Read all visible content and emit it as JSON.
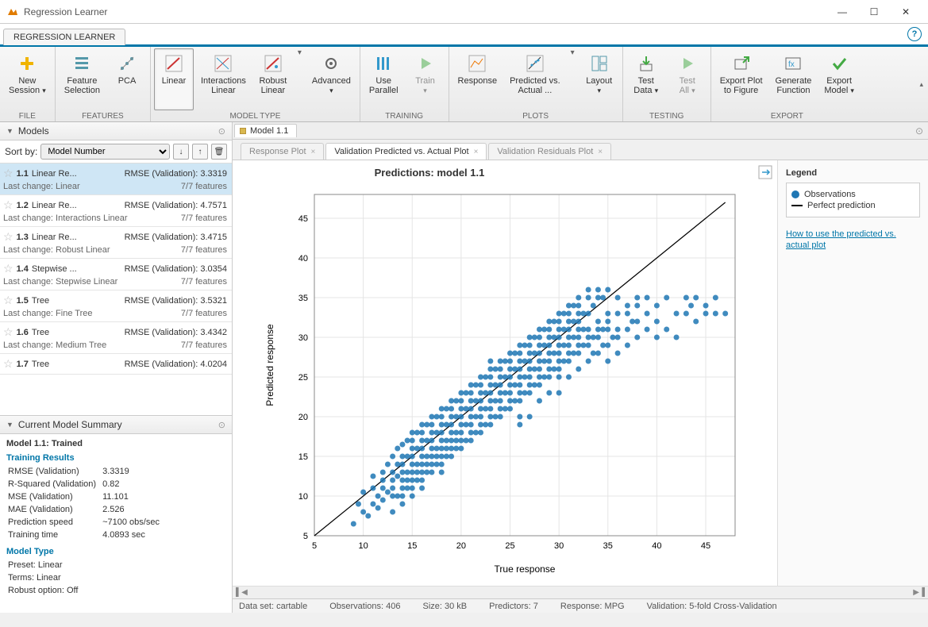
{
  "window": {
    "title": "Regression Learner"
  },
  "app_tab": "REGRESSION LEARNER",
  "toolstrip": {
    "file": {
      "label": "FILE",
      "new_session": "New\nSession"
    },
    "features": {
      "label": "FEATURES",
      "feature_selection": "Feature\nSelection",
      "pca": "PCA"
    },
    "model_type": {
      "label": "MODEL TYPE",
      "linear": "Linear",
      "interactions": "Interactions\nLinear",
      "robust": "Robust\nLinear",
      "advanced": "Advanced"
    },
    "training": {
      "label": "TRAINING",
      "use_parallel": "Use\nParallel",
      "train": "Train"
    },
    "plots": {
      "label": "PLOTS",
      "response": "Response",
      "pred_actual": "Predicted vs.\nActual  ...",
      "layout": "Layout"
    },
    "testing": {
      "label": "TESTING",
      "test_data": "Test\nData",
      "test_all": "Test\nAll"
    },
    "export": {
      "label": "EXPORT",
      "export_plot": "Export Plot\nto Figure",
      "generate_fn": "Generate\nFunction",
      "export_model": "Export\nModel"
    }
  },
  "models_panel": {
    "title": "Models",
    "sort_label": "Sort by:",
    "sort_value": "Model Number",
    "items": [
      {
        "id": "1.1",
        "name": "Linear Re...",
        "metric": "RMSE (Validation): 3.3319",
        "last_change": "Last change: Linear",
        "features": "7/7 features",
        "selected": true
      },
      {
        "id": "1.2",
        "name": "Linear Re...",
        "metric": "RMSE (Validation): 4.7571",
        "last_change": "Last change: Interactions Linear",
        "features": "7/7 features"
      },
      {
        "id": "1.3",
        "name": "Linear Re...",
        "metric": "RMSE (Validation): 3.4715",
        "last_change": "Last change: Robust Linear",
        "features": "7/7 features"
      },
      {
        "id": "1.4",
        "name": "Stepwise ...",
        "metric": "RMSE (Validation): 3.0354",
        "last_change": "Last change: Stepwise Linear",
        "features": "7/7 features"
      },
      {
        "id": "1.5",
        "name": "Tree",
        "metric": "RMSE (Validation): 3.5321",
        "last_change": "Last change: Fine Tree",
        "features": "7/7 features"
      },
      {
        "id": "1.6",
        "name": "Tree",
        "metric": "RMSE (Validation): 3.4342",
        "last_change": "Last change: Medium Tree",
        "features": "7/7 features"
      },
      {
        "id": "1.7",
        "name": "Tree",
        "metric": "RMSE (Validation): 4.0204",
        "last_change": "",
        "features": ""
      }
    ]
  },
  "summary": {
    "title": "Current Model Summary",
    "heading": "Model 1.1: Trained",
    "training_results_label": "Training Results",
    "rows": [
      [
        "RMSE (Validation)",
        "3.3319"
      ],
      [
        "R-Squared (Validation)",
        "0.82"
      ],
      [
        "MSE (Validation)",
        "11.101"
      ],
      [
        "MAE (Validation)",
        "2.526"
      ],
      [
        "Prediction speed",
        "~7100 obs/sec"
      ],
      [
        "Training time",
        "4.0893 sec"
      ]
    ],
    "model_type_label": "Model Type",
    "mt_rows": [
      [
        "Preset:",
        "Linear"
      ],
      [
        "Terms:",
        "Linear"
      ],
      [
        "Robust option:",
        "Off"
      ]
    ]
  },
  "doc_tab": "Model 1.1",
  "plot_tabs": {
    "response": "Response Plot",
    "pred_actual": "Validation Predicted vs. Actual Plot",
    "residuals": "Validation Residuals Plot"
  },
  "chart_data": {
    "type": "scatter",
    "title": "Predictions: model 1.1",
    "xlabel": "True response",
    "ylabel": "Predicted response",
    "xlim": [
      5,
      48
    ],
    "ylim": [
      5,
      48
    ],
    "xticks": [
      5,
      10,
      15,
      20,
      25,
      30,
      35,
      40,
      45
    ],
    "yticks": [
      5,
      10,
      15,
      20,
      25,
      30,
      35,
      40,
      45
    ],
    "perfect_line": {
      "x0": 5,
      "y0": 5,
      "x1": 47,
      "y1": 47
    },
    "legend": {
      "observations": "Observations",
      "perfect": "Perfect prediction"
    },
    "points": [
      [
        9,
        6.5
      ],
      [
        9.5,
        9
      ],
      [
        10,
        8
      ],
      [
        10,
        10.5
      ],
      [
        10.5,
        7.5
      ],
      [
        11,
        9
      ],
      [
        11,
        11
      ],
      [
        11,
        12.5
      ],
      [
        11.5,
        10
      ],
      [
        11.5,
        8.5
      ],
      [
        12,
        11
      ],
      [
        12,
        12
      ],
      [
        12,
        13
      ],
      [
        12,
        9.5
      ],
      [
        12.5,
        10.5
      ],
      [
        12.5,
        14
      ],
      [
        13,
        11
      ],
      [
        13,
        12
      ],
      [
        13,
        13
      ],
      [
        13,
        15
      ],
      [
        13,
        10
      ],
      [
        13,
        8
      ],
      [
        13.5,
        12.5
      ],
      [
        13.5,
        14
      ],
      [
        13.5,
        10
      ],
      [
        13.5,
        16
      ],
      [
        14,
        12
      ],
      [
        14,
        13
      ],
      [
        14,
        14
      ],
      [
        14,
        15
      ],
      [
        14,
        11
      ],
      [
        14,
        10
      ],
      [
        14,
        16.5
      ],
      [
        14,
        9
      ],
      [
        14.5,
        13
      ],
      [
        14.5,
        15
      ],
      [
        14.5,
        11
      ],
      [
        14.5,
        17
      ],
      [
        14.5,
        12
      ],
      [
        15,
        12
      ],
      [
        15,
        13
      ],
      [
        15,
        14
      ],
      [
        15,
        15
      ],
      [
        15,
        16
      ],
      [
        15,
        17
      ],
      [
        15,
        11
      ],
      [
        15,
        18
      ],
      [
        15,
        10
      ],
      [
        15.5,
        14
      ],
      [
        15.5,
        16
      ],
      [
        15.5,
        12
      ],
      [
        15.5,
        18
      ],
      [
        15.5,
        13
      ],
      [
        16,
        14
      ],
      [
        16,
        15
      ],
      [
        16,
        16
      ],
      [
        16,
        17
      ],
      [
        16,
        13
      ],
      [
        16,
        18
      ],
      [
        16,
        12
      ],
      [
        16,
        19
      ],
      [
        16,
        11
      ],
      [
        16.5,
        15
      ],
      [
        16.5,
        17
      ],
      [
        16.5,
        13
      ],
      [
        16.5,
        19
      ],
      [
        16.5,
        14
      ],
      [
        17,
        15
      ],
      [
        17,
        16
      ],
      [
        17,
        17
      ],
      [
        17,
        18
      ],
      [
        17,
        14
      ],
      [
        17,
        19
      ],
      [
        17,
        13
      ],
      [
        17,
        20
      ],
      [
        17.5,
        16
      ],
      [
        17.5,
        18
      ],
      [
        17.5,
        14
      ],
      [
        17.5,
        20
      ],
      [
        17.5,
        15
      ],
      [
        18,
        16
      ],
      [
        18,
        17
      ],
      [
        18,
        18
      ],
      [
        18,
        19
      ],
      [
        18,
        15
      ],
      [
        18,
        20
      ],
      [
        18,
        14
      ],
      [
        18,
        21
      ],
      [
        18,
        13
      ],
      [
        18.5,
        17
      ],
      [
        18.5,
        19
      ],
      [
        18.5,
        15
      ],
      [
        18.5,
        21
      ],
      [
        18.5,
        16
      ],
      [
        19,
        17
      ],
      [
        19,
        18
      ],
      [
        19,
        19
      ],
      [
        19,
        20
      ],
      [
        19,
        16
      ],
      [
        19,
        21
      ],
      [
        19,
        15
      ],
      [
        19,
        22
      ],
      [
        19.5,
        18
      ],
      [
        19.5,
        20
      ],
      [
        19.5,
        16
      ],
      [
        19.5,
        22
      ],
      [
        19.5,
        17
      ],
      [
        20,
        18
      ],
      [
        20,
        19
      ],
      [
        20,
        20
      ],
      [
        20,
        21
      ],
      [
        20,
        17
      ],
      [
        20,
        22
      ],
      [
        20,
        16
      ],
      [
        20,
        23
      ],
      [
        20.5,
        19
      ],
      [
        20.5,
        21
      ],
      [
        20.5,
        17
      ],
      [
        20.5,
        23
      ],
      [
        21,
        19
      ],
      [
        21,
        20
      ],
      [
        21,
        21
      ],
      [
        21,
        22
      ],
      [
        21,
        18
      ],
      [
        21,
        23
      ],
      [
        21,
        17
      ],
      [
        21,
        24
      ],
      [
        21.5,
        20
      ],
      [
        21.5,
        22
      ],
      [
        21.5,
        18
      ],
      [
        21.5,
        24
      ],
      [
        22,
        20
      ],
      [
        22,
        21
      ],
      [
        22,
        22
      ],
      [
        22,
        23
      ],
      [
        22,
        19
      ],
      [
        22,
        24
      ],
      [
        22,
        18
      ],
      [
        22,
        25
      ],
      [
        22.5,
        21
      ],
      [
        22.5,
        23
      ],
      [
        22.5,
        19
      ],
      [
        22.5,
        25
      ],
      [
        23,
        21
      ],
      [
        23,
        22
      ],
      [
        23,
        23
      ],
      [
        23,
        24
      ],
      [
        23,
        20
      ],
      [
        23,
        25
      ],
      [
        23,
        19
      ],
      [
        23,
        26
      ],
      [
        23,
        27
      ],
      [
        23.5,
        22
      ],
      [
        23.5,
        24
      ],
      [
        23.5,
        20
      ],
      [
        23.5,
        26
      ],
      [
        24,
        22
      ],
      [
        24,
        23
      ],
      [
        24,
        24
      ],
      [
        24,
        25
      ],
      [
        24,
        21
      ],
      [
        24,
        26
      ],
      [
        24,
        20
      ],
      [
        24,
        27
      ],
      [
        24.5,
        23
      ],
      [
        24.5,
        25
      ],
      [
        24.5,
        21
      ],
      [
        24.5,
        27
      ],
      [
        25,
        23
      ],
      [
        25,
        24
      ],
      [
        25,
        25
      ],
      [
        25,
        26
      ],
      [
        25,
        22
      ],
      [
        25,
        27
      ],
      [
        25,
        21
      ],
      [
        25,
        28
      ],
      [
        25.5,
        24
      ],
      [
        25.5,
        26
      ],
      [
        25.5,
        22
      ],
      [
        25.5,
        28
      ],
      [
        26,
        24
      ],
      [
        26,
        25
      ],
      [
        26,
        26
      ],
      [
        26,
        27
      ],
      [
        26,
        23
      ],
      [
        26,
        28
      ],
      [
        26,
        22
      ],
      [
        26,
        29
      ],
      [
        26,
        19
      ],
      [
        26,
        20
      ],
      [
        26.5,
        25
      ],
      [
        26.5,
        27
      ],
      [
        26.5,
        23
      ],
      [
        26.5,
        29
      ],
      [
        27,
        25
      ],
      [
        27,
        26
      ],
      [
        27,
        27
      ],
      [
        27,
        28
      ],
      [
        27,
        24
      ],
      [
        27,
        29
      ],
      [
        27,
        23
      ],
      [
        27,
        30
      ],
      [
        27,
        20
      ],
      [
        27.5,
        26
      ],
      [
        27.5,
        28
      ],
      [
        27.5,
        24
      ],
      [
        27.5,
        30
      ],
      [
        28,
        26
      ],
      [
        28,
        27
      ],
      [
        28,
        28
      ],
      [
        28,
        29
      ],
      [
        28,
        25
      ],
      [
        28,
        30
      ],
      [
        28,
        24
      ],
      [
        28,
        31
      ],
      [
        28,
        22
      ],
      [
        28.5,
        27
      ],
      [
        28.5,
        29
      ],
      [
        28.5,
        25
      ],
      [
        28.5,
        31
      ],
      [
        29,
        27
      ],
      [
        29,
        28
      ],
      [
        29,
        29
      ],
      [
        29,
        30
      ],
      [
        29,
        26
      ],
      [
        29,
        31
      ],
      [
        29,
        25
      ],
      [
        29,
        32
      ],
      [
        29,
        23
      ],
      [
        29.5,
        28
      ],
      [
        29.5,
        30
      ],
      [
        29.5,
        26
      ],
      [
        29.5,
        32
      ],
      [
        30,
        28
      ],
      [
        30,
        29
      ],
      [
        30,
        30
      ],
      [
        30,
        31
      ],
      [
        30,
        27
      ],
      [
        30,
        32
      ],
      [
        30,
        26
      ],
      [
        30,
        33
      ],
      [
        30,
        25
      ],
      [
        30,
        23
      ],
      [
        30.5,
        29
      ],
      [
        30.5,
        31
      ],
      [
        30.5,
        27
      ],
      [
        30.5,
        33
      ],
      [
        31,
        29
      ],
      [
        31,
        30
      ],
      [
        31,
        31
      ],
      [
        31,
        32
      ],
      [
        31,
        28
      ],
      [
        31,
        33
      ],
      [
        31,
        27
      ],
      [
        31,
        34
      ],
      [
        31,
        25
      ],
      [
        31.5,
        30
      ],
      [
        31.5,
        32
      ],
      [
        31.5,
        28
      ],
      [
        31.5,
        34
      ],
      [
        32,
        30
      ],
      [
        32,
        31
      ],
      [
        32,
        32
      ],
      [
        32,
        33
      ],
      [
        32,
        29
      ],
      [
        32,
        34
      ],
      [
        32,
        28
      ],
      [
        32,
        35
      ],
      [
        32,
        26
      ],
      [
        32.5,
        31
      ],
      [
        32.5,
        33
      ],
      [
        32.5,
        29
      ],
      [
        33,
        29
      ],
      [
        33,
        30
      ],
      [
        33,
        33
      ],
      [
        33,
        35
      ],
      [
        33,
        27
      ],
      [
        33,
        31
      ],
      [
        33,
        36
      ],
      [
        33.5,
        30
      ],
      [
        33.5,
        34
      ],
      [
        33.5,
        28
      ],
      [
        34,
        30
      ],
      [
        34,
        32
      ],
      [
        34,
        35
      ],
      [
        34,
        28
      ],
      [
        34,
        31
      ],
      [
        34,
        36
      ],
      [
        34.5,
        31
      ],
      [
        34.5,
        35
      ],
      [
        34.5,
        29
      ],
      [
        35,
        31
      ],
      [
        35,
        33
      ],
      [
        35,
        36
      ],
      [
        35,
        29
      ],
      [
        35,
        32
      ],
      [
        35,
        27
      ],
      [
        35.5,
        30
      ],
      [
        36,
        30
      ],
      [
        36,
        33
      ],
      [
        36,
        35
      ],
      [
        36,
        28
      ],
      [
        36,
        31
      ],
      [
        37,
        31
      ],
      [
        37,
        34
      ],
      [
        37,
        29
      ],
      [
        37,
        33
      ],
      [
        37.5,
        32
      ],
      [
        38,
        32
      ],
      [
        38,
        35
      ],
      [
        38,
        30
      ],
      [
        38,
        34
      ],
      [
        39,
        31
      ],
      [
        39,
        33
      ],
      [
        39,
        35
      ],
      [
        40,
        32
      ],
      [
        40,
        34
      ],
      [
        40,
        30
      ],
      [
        41,
        31
      ],
      [
        41,
        35
      ],
      [
        42,
        33
      ],
      [
        42,
        30
      ],
      [
        43,
        33
      ],
      [
        43,
        35
      ],
      [
        43.5,
        34
      ],
      [
        44,
        32
      ],
      [
        44,
        35
      ],
      [
        45,
        33
      ],
      [
        45,
        34
      ],
      [
        46,
        35
      ],
      [
        46,
        33
      ],
      [
        47,
        33
      ]
    ]
  },
  "legend_link": "How to use the predicted vs. actual plot",
  "legend_title": "Legend",
  "status": {
    "dataset": "Data set: cartable",
    "obs": "Observations: 406",
    "size": "Size: 30 kB",
    "predictors": "Predictors: 7",
    "response": "Response: MPG",
    "validation": "Validation: 5-fold Cross-Validation"
  }
}
